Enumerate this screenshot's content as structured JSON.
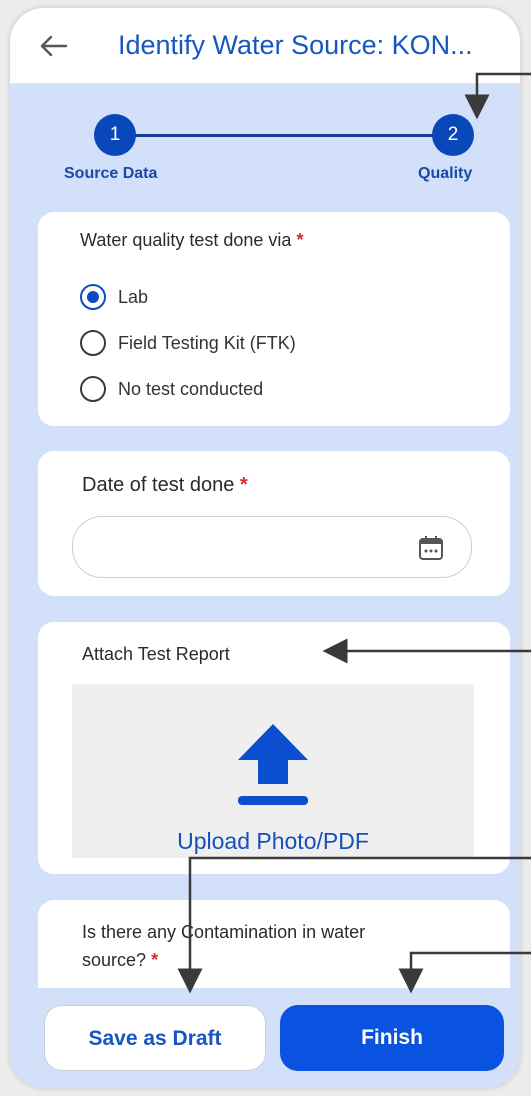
{
  "header": {
    "title": "Identify Water Source: KON...",
    "back_icon": "arrow-left-icon"
  },
  "stepper": {
    "steps": [
      {
        "number": "1",
        "label": "Source Data"
      },
      {
        "number": "2",
        "label": "Quality"
      }
    ],
    "current_step": 2
  },
  "test_method": {
    "label": "Water quality test done via",
    "required_mark": "*",
    "options": [
      {
        "label": "Lab",
        "selected": true
      },
      {
        "label": "Field Testing Kit (FTK)",
        "selected": false
      },
      {
        "label": "No test conducted",
        "selected": false
      }
    ]
  },
  "test_date": {
    "label": "Date of test done",
    "required_mark": "*",
    "value": "",
    "icon": "calendar-icon"
  },
  "attachment": {
    "label": "Attach Test Report",
    "upload_label": "Upload Photo/PDF",
    "icon": "upload-icon"
  },
  "contamination": {
    "label": "Is there any Contamination in water source?",
    "label_line1": "Is there any Contamination in water",
    "label_line2": "source?",
    "required_mark": "*"
  },
  "actions": {
    "save_draft_label": "Save as Draft",
    "finish_label": "Finish"
  },
  "colors": {
    "primary": "#0a52e0",
    "step_active": "#0a47b8",
    "background": "#d3e0fa",
    "required": "#d32f2f"
  }
}
